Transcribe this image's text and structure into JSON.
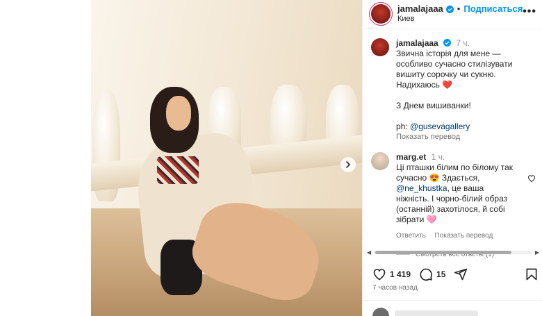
{
  "post": {
    "author": {
      "username": "jamalajaaa",
      "follow_label": "Подписаться",
      "location": "Киев",
      "more_label": "•••"
    },
    "caption": {
      "username": "jamalajaaa",
      "time": "7 ч.",
      "lines": [
        "Звична історія для мене — особливо сучасно стилізувати вишиту сорочку чи сукню.",
        "Надихаюсь ❤️",
        "",
        "З Днем вишиванки!",
        "",
        "ph: "
      ],
      "photo_credit": "@gusevagallery",
      "translate_label": "Показать перевод"
    },
    "comment": {
      "username": "marg.et",
      "time": "1 ч.",
      "text_before": "Ці пташки білим по білому так сучасно 😍 Здається, ",
      "mention": "@ne_khustka",
      "text_after": ", це ваша ніжність. І чорно-білий образ (останній) захотілося, й собі зібрати 🩷",
      "reply_label": "Ответить",
      "translate_label": "Показать перевод",
      "view_replies_label": "Смотреть все ответы (1)"
    },
    "likes_count": "1 419",
    "comments_count": "15",
    "posted_ago": "7 часов назад",
    "icons": {
      "like": "heart-icon",
      "comment": "speech-bubble-icon",
      "share": "paper-plane-icon",
      "save": "bookmark-icon",
      "next": "chevron-right-icon",
      "verified": "verified-badge-icon"
    },
    "colors": {
      "accent": "#0095f6",
      "link": "#00376b",
      "muted": "#737373"
    }
  }
}
